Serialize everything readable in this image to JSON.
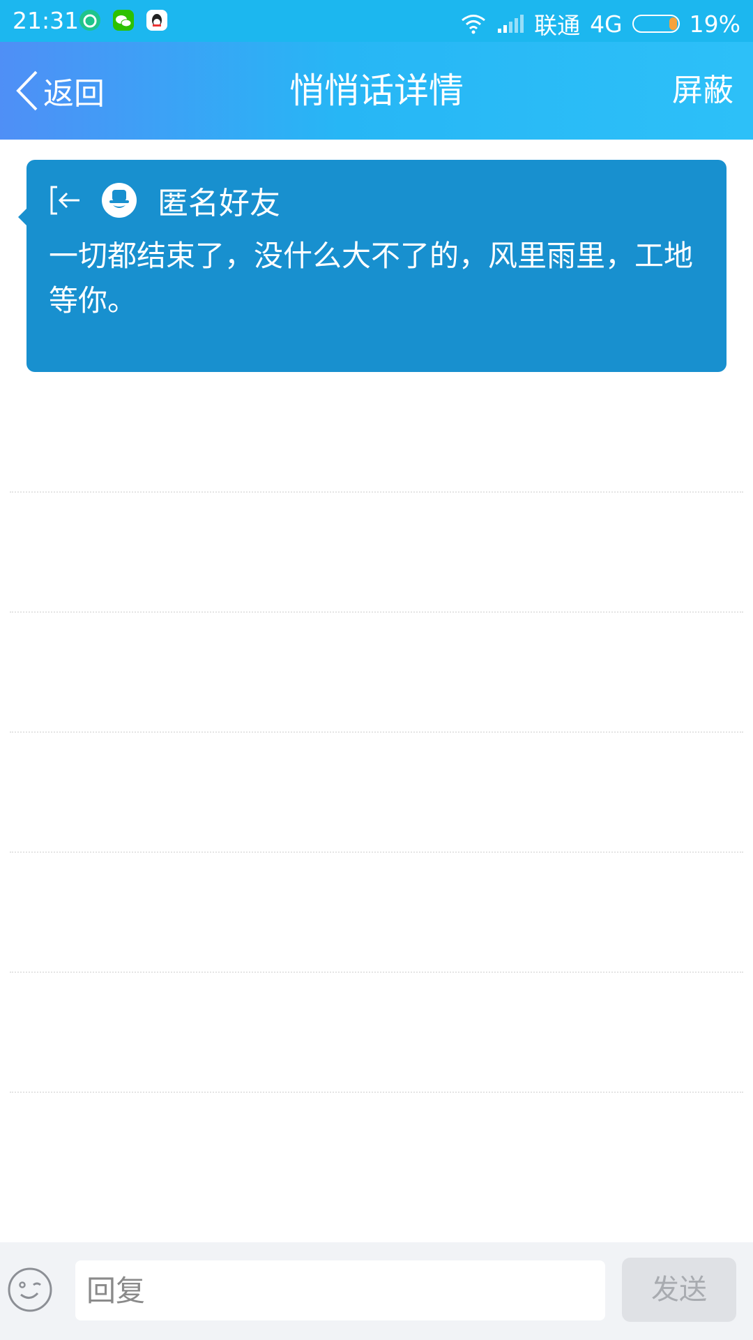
{
  "status_bar": {
    "time": "21:31",
    "app_icons": [
      {
        "name": "green-app-icon",
        "color": "#1fc48b"
      },
      {
        "name": "wechat-icon",
        "color": "#2dc100"
      },
      {
        "name": "qq-icon",
        "color": "#ffffff"
      }
    ],
    "carrier": "联通",
    "network": "4G",
    "battery_level": 0.19,
    "battery_text": "19%"
  },
  "header": {
    "back_label": "返回",
    "title": "悄悄话详情",
    "action_label": "屏蔽"
  },
  "message": {
    "sender": "匿名好友",
    "text": "一切都结束了，没什么大不了的，风里雨里，工地等你。"
  },
  "reply": {
    "placeholder": "回复",
    "send_label": "发送"
  },
  "colors": {
    "status_bar": "#1cb7ef",
    "card": "#1890cf",
    "send_disabled": "#dfe1e5"
  }
}
